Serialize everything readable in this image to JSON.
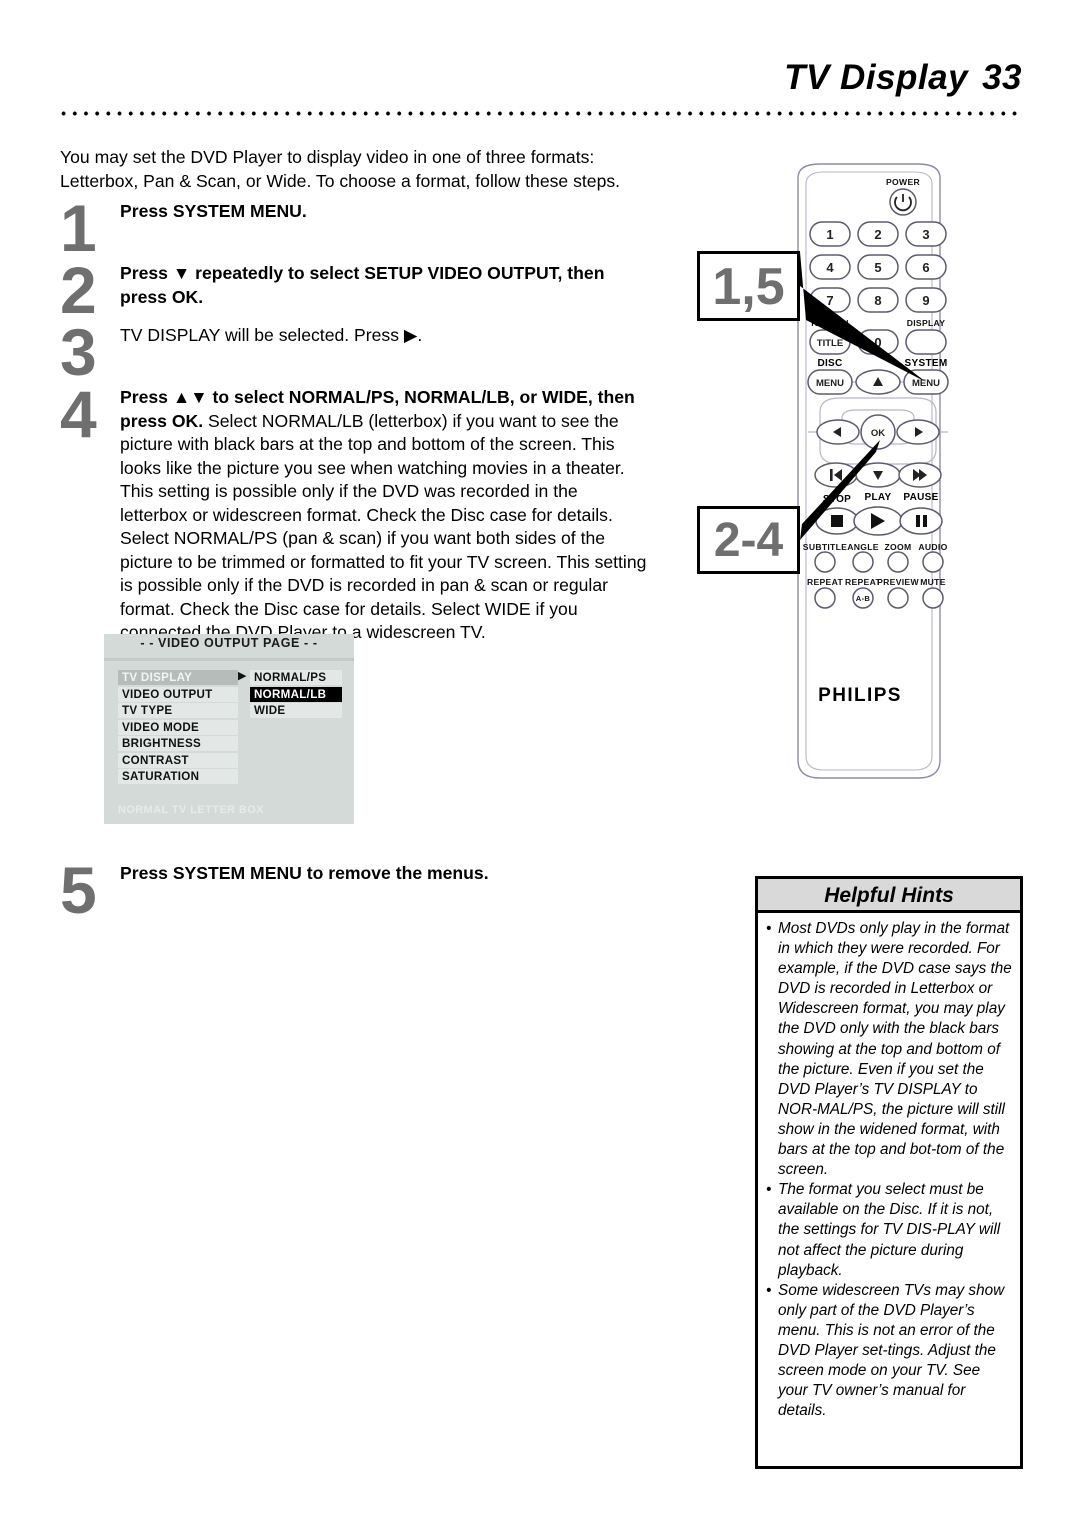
{
  "header": {
    "title": "TV Display",
    "page_number": "33"
  },
  "intro": "You may set the DVD Player to display video in one of three formats: Letterbox, Pan & Scan, or Wide. To choose a format, follow these steps.",
  "steps": [
    {
      "number": "1",
      "lead": "Press SYSTEM MENU.",
      "detail": ""
    },
    {
      "number": "2",
      "lead": "Press ▼ repeatedly to select SETUP VIDEO OUTPUT, then press OK.",
      "detail": ""
    },
    {
      "number": "3",
      "lead": "",
      "detail": "TV DISPLAY will be selected. Press ▶."
    },
    {
      "number": "4",
      "lead": "Press ▲▼ to select NORMAL/PS, NORMAL/LB, or WIDE, then press OK.",
      "detail": "Select NORMAL/LB (letterbox) if you want to see the picture with black bars at the top and bottom of the screen. This looks like the picture you see when watching movies in a theater. This setting is possible only if the DVD was recorded in the letterbox or widescreen format. Check the Disc case for details. Select NORMAL/PS (pan & scan) if you want both sides of the picture to be trimmed or formatted to fit your TV screen. This setting is possible only if the DVD is recorded in pan & scan or regular format. Check the Disc case for details. Select WIDE if you connected the DVD Player to a widescreen TV."
    },
    {
      "number": "5",
      "lead": "Press SYSTEM MENU to remove the menus.",
      "detail": ""
    }
  ],
  "osd": {
    "title": "- -  VIDEO OUTPUT PAGE  - -",
    "left_items": [
      "TV DISPLAY",
      "VIDEO OUTPUT",
      "TV TYPE",
      "VIDEO MODE",
      "BRIGHTNESS",
      "CONTRAST",
      "SATURATION"
    ],
    "selected_left": "TV DISPLAY",
    "caret": "▶",
    "right_items": [
      "NORMAL/PS",
      "NORMAL/LB",
      "WIDE"
    ],
    "highlighted_right": "NORMAL/LB",
    "status": "NORMAL TV LETTER BOX",
    "colors": {
      "background": "#d4dad8",
      "row": "#e3e8e6",
      "selected": "#b4bdba",
      "highlight": "#000000"
    }
  },
  "remote": {
    "brand": "PHILIPS",
    "power_label": "POWER",
    "keypad": [
      "1",
      "2",
      "3",
      "4",
      "5",
      "6",
      "7",
      "8",
      "9",
      "0"
    ],
    "return_label": "RETURN",
    "title_button": "TITLE",
    "display_label": "DISPLAY",
    "disc_label": "DISC",
    "system_label": "SYSTEM",
    "disc_menu_button": "MENU",
    "system_menu_button": "MENU",
    "ok_button": "OK",
    "stop_label": "STOP",
    "play_label": "PLAY",
    "pause_label": "PAUSE",
    "function_row_1": [
      "SUBTITLE",
      "ANGLE",
      "ZOOM",
      "AUDIO"
    ],
    "function_row_2": [
      "REPEAT",
      "REPEAT",
      "PREVIEW",
      "MUTE"
    ],
    "repeat_ab_label": "A-B",
    "callouts": [
      {
        "id": "callout-1-5",
        "label": "1,5",
        "points_to": "system-menu-button"
      },
      {
        "id": "callout-2-4",
        "label": "2-4",
        "points_to": "ok-button"
      }
    ]
  },
  "hints": {
    "title": "Helpful Hints",
    "bullet": "•",
    "items": [
      "Most DVDs only play in the format in which they were recorded. For example, if the DVD case says the DVD is recorded in Letterbox or Widescreen format, you may play the DVD only with the black bars showing at the top and bottom of the picture. Even if you set the DVD Player’s TV DISPLAY to NOR-MAL/PS, the picture will still show in the widened format, with bars at the top and bot-tom of the screen.",
      "The format you select must be available on the Disc. If it is not, the settings for TV DIS-PLAY will not affect the picture during playback.",
      "Some widescreen TVs may show only part of the DVD Player’s menu. This is not an error of the DVD Player set-tings. Adjust the screen mode on your TV. See your TV owner’s manual for details."
    ]
  }
}
